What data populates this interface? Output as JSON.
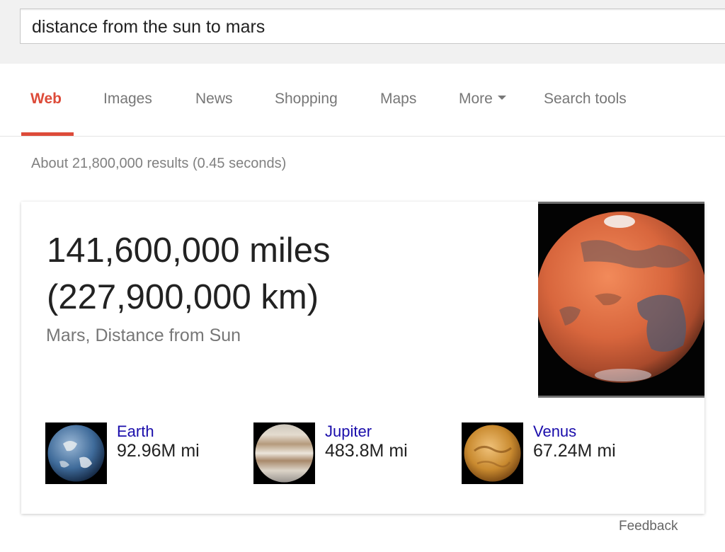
{
  "search": {
    "query": "distance from the sun to mars"
  },
  "tabs": [
    {
      "label": "Web",
      "active": true
    },
    {
      "label": "Images",
      "active": false
    },
    {
      "label": "News",
      "active": false
    },
    {
      "label": "Shopping",
      "active": false
    },
    {
      "label": "Maps",
      "active": false
    },
    {
      "label": "More",
      "active": false
    },
    {
      "label": "Search tools",
      "active": false
    }
  ],
  "result_stats": "About 21,800,000 results (0.45 seconds)",
  "answer": {
    "line1": "141,600,000 miles",
    "line2": "(227,900,000 km)",
    "subtitle": "Mars, Distance from Sun",
    "image_icon": "mars-planet-image"
  },
  "related": [
    {
      "name": "Earth",
      "distance": "92.96M mi",
      "icon": "earth-image"
    },
    {
      "name": "Jupiter",
      "distance": "483.8M mi",
      "icon": "jupiter-image"
    },
    {
      "name": "Venus",
      "distance": "67.24M mi",
      "icon": "venus-image"
    }
  ],
  "feedback_label": "Feedback",
  "colors": {
    "accent": "#dd4b39",
    "link": "#1a0dab",
    "muted": "#777777"
  }
}
